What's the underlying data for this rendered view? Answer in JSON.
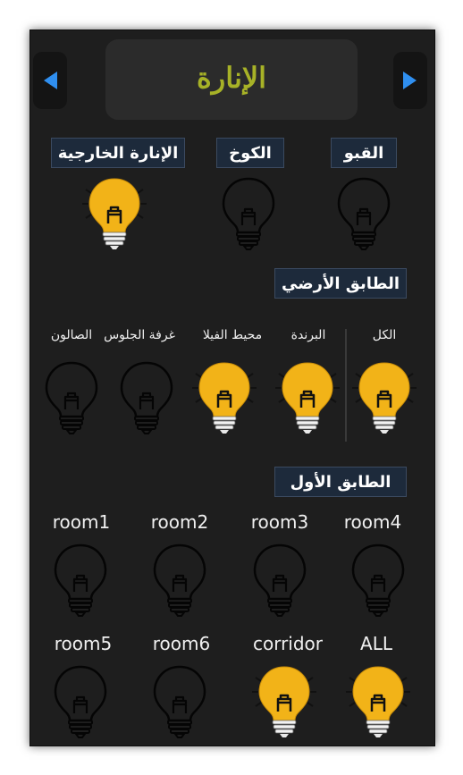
{
  "title": "الإنارة",
  "groups": {
    "top": {
      "items": [
        {
          "label": "القبو",
          "on": false
        },
        {
          "label": "الكوخ",
          "on": false
        },
        {
          "label": "الإنارة الخارجية",
          "on": true
        }
      ]
    },
    "ground": {
      "heading": "الطابق الأرضي",
      "items": [
        {
          "label": "الكل",
          "on": true
        },
        {
          "label": "البرندة",
          "on": true
        },
        {
          "label": "محيط الفيلا",
          "on": true
        },
        {
          "label": "غرفة الجلوس",
          "on": false
        },
        {
          "label": "الصالون",
          "on": false
        }
      ]
    },
    "first": {
      "heading": "الطابق الأول",
      "items": [
        {
          "label": "room1",
          "on": false
        },
        {
          "label": "room2",
          "on": false
        },
        {
          "label": "room3",
          "on": false
        },
        {
          "label": "room4",
          "on": false
        },
        {
          "label": "room5",
          "on": false
        },
        {
          "label": "room6",
          "on": false
        },
        {
          "label": "corridor",
          "on": true
        },
        {
          "label": "ALL",
          "on": true
        }
      ]
    }
  },
  "colors": {
    "bulb_on": "#f2b318",
    "bulb_off_outline": "#050505",
    "title": "#a7b227",
    "tag_bg": "#1d2a3b",
    "nav_arrow": "#2f8ff0"
  },
  "icons": {
    "nav_left": "triangle-left-icon",
    "nav_right": "triangle-right-icon",
    "bulb": "light-bulb-icon"
  }
}
